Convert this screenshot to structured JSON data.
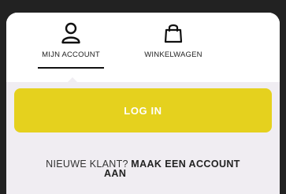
{
  "tabs": {
    "account": {
      "label": "MIJN ACCOUNT",
      "icon": "user-icon",
      "active": true
    },
    "cart": {
      "label": "WINKELWAGEN",
      "icon": "shopping-bag-icon",
      "active": false
    }
  },
  "login": {
    "button_label": "LOG IN"
  },
  "signup": {
    "prompt": "NIEUWE KLANT?",
    "link_line1": "MAAK EEN ACCOUNT",
    "link_line2": "AAN"
  },
  "colors": {
    "accent": "#e5d11e",
    "panel_bg": "#f0edf2",
    "backdrop": "#222222"
  }
}
